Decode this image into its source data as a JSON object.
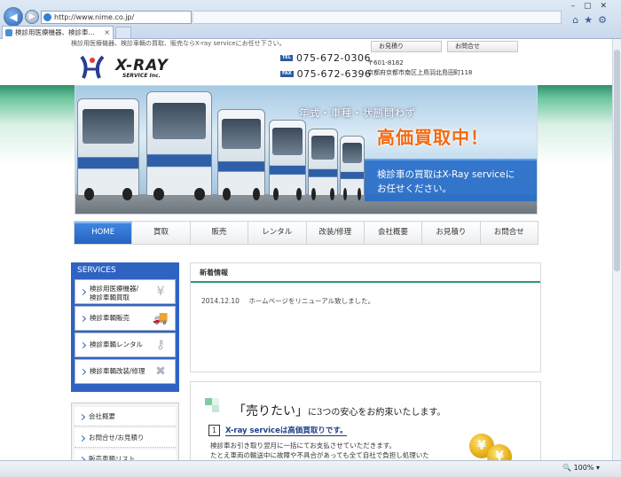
{
  "browser": {
    "url": "http://www.nime.co.jp/",
    "tab_title": "検診用医療機器、検診車...",
    "zoom": "100%",
    "close_glyph": "×"
  },
  "header": {
    "tagline": "検診用医療機器、検診車輌の買取、販売ならX-ray serviceにお任せ下さい。",
    "top_links": [
      "お見積り",
      "お問合せ"
    ],
    "logo_text": "X-RAY",
    "logo_sub": "SERVICE Inc.",
    "tel_tag": "TEL",
    "fax_tag": "FAX",
    "tel": "075-672-0306",
    "fax": "075-672-6396",
    "postal": "〒601-8182",
    "address": "京都府京都市南区上鳥羽北島田町118"
  },
  "hero": {
    "sub": "年式・車種・状態問わず",
    "main": "高価買取中！",
    "box_line1": "検診車の買取はX-Ray serviceに",
    "box_line2": "お任せください。"
  },
  "nav": [
    "HOME",
    "買取",
    "販売",
    "レンタル",
    "改装/修理",
    "会社概要",
    "お見積り",
    "お問合せ"
  ],
  "services": {
    "title": "SERVICES",
    "items": [
      {
        "line1": "検診用医療機器/",
        "line2": "検診車輌買取",
        "icon": "yen-coin-icon",
        "glyph": "¥"
      },
      {
        "line1": "検診車輌販売",
        "line2": "",
        "icon": "truck-icon",
        "glyph": "🚚"
      },
      {
        "line1": "検診車輌レンタル",
        "line2": "",
        "icon": "key-icon",
        "glyph": "⚷"
      },
      {
        "line1": "検診車輌改装/修理",
        "line2": "",
        "icon": "tools-icon",
        "glyph": "✖"
      }
    ]
  },
  "sidebar2": [
    "会社概要",
    "お問合せ/お見積り",
    "販売車輌リスト"
  ],
  "news": {
    "title": "新着情報",
    "date": "2014.12.10",
    "text": "ホームページをリニューアル致しました。"
  },
  "sell": {
    "quote": "「売りたい」",
    "heading_rest": "に3つの安心をお約束いたします。",
    "point_num": "1",
    "point_title": "X-ray serviceは高価買取りです。",
    "body_line1": "検診車お引き取り翌月に一括にてお支払させていただきます。",
    "body_line2": "たとえ車両の輸送中に故障や不具合があっても全て自社で負担し処理いた"
  },
  "colors": {
    "brand_blue": "#2f63c2",
    "accent_orange": "#f36a12",
    "green": "#2f9a6a"
  }
}
